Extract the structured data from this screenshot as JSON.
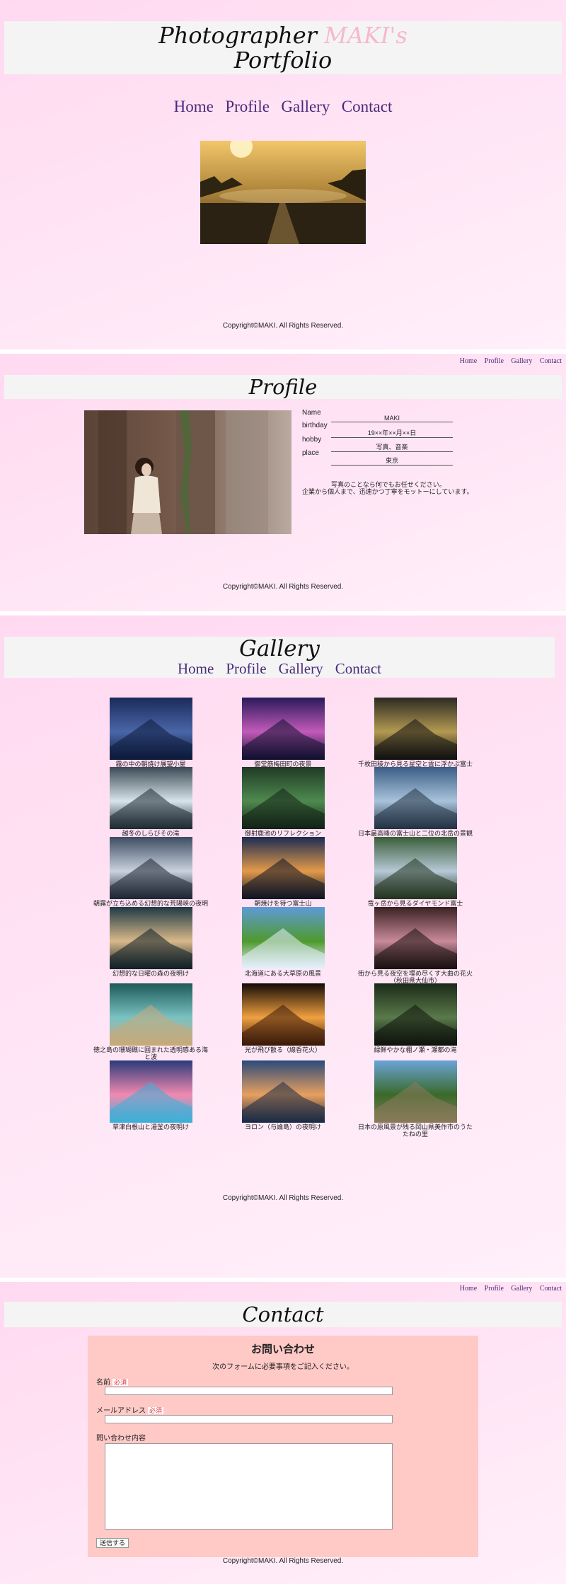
{
  "header": {
    "title_part1": "Photographer",
    "title_name": "MAKI's",
    "title_part2": "Portfolio"
  },
  "nav": {
    "home": "Home",
    "profile": "Profile",
    "gallery": "Gallery",
    "contact": "Contact"
  },
  "footer": {
    "copyright": "Copyright©MAKI. All Rights Reserved."
  },
  "profile": {
    "heading": "Profile",
    "fields": [
      {
        "label": "Name",
        "value": "MAKI"
      },
      {
        "label": "birthday",
        "value": "19××年××月××日"
      },
      {
        "label": "hobby",
        "value": "写真、音楽"
      },
      {
        "label": "place",
        "value": "東京"
      }
    ],
    "message_line1": "写真のことなら何でもお任せください。",
    "message_line2": "企業から個人まで、迅速かつ丁寧をモットーにしています。"
  },
  "gallery": {
    "heading": "Gallery",
    "items": [
      {
        "caption": "霧の中の朝焼け展望小屋"
      },
      {
        "caption": "御堂筋梅田町の夜景"
      },
      {
        "caption": "千枚田稜から見る星空と雲に浮かぶ富士山"
      },
      {
        "caption": "越冬のしらびその滝"
      },
      {
        "caption": "御射鹿池のリフレクション"
      },
      {
        "caption": "日本最高峰の富士山と二位の北岳の景観"
      },
      {
        "caption": "朝霧が立ち込める幻想的な荒陽峡の夜明け"
      },
      {
        "caption": "朝焼けを待つ富士山"
      },
      {
        "caption": "竜ヶ岳から見るダイヤモンド富士"
      },
      {
        "caption": "幻想的な日曜の森の夜明け"
      },
      {
        "caption": "北海道にある大草原の風景"
      },
      {
        "caption": "街から見る夜空を埋め尽くす大曲の花火（秋田県大仙市）"
      },
      {
        "caption": "徳之島の珊瑚礁に囲まれた透明感ある海と波"
      },
      {
        "caption": "光が飛び散る（線香花火）"
      },
      {
        "caption": "緑鮮やかな棚ノ瀬・瀬都の滝"
      },
      {
        "caption": "草津白根山と湯釜の夜明け"
      },
      {
        "caption": "ヨロン（与論島）の夜明け"
      },
      {
        "caption": "日本の原風景が残る岡山県美作市のうたたねの里"
      }
    ]
  },
  "contact": {
    "heading": "Contact",
    "form_title": "お問い合わせ",
    "intro": "次のフォームに必要事項をご記入ください。",
    "name_label": "名前",
    "email_label": "メールアドレス",
    "required": "必須",
    "message_label": "問い合わせ内容",
    "submit": "送信する"
  },
  "colors": {
    "accent_name": "#f7b8cf",
    "nav_link": "#4a2a7a",
    "form_bg": "#ffc9c6"
  }
}
